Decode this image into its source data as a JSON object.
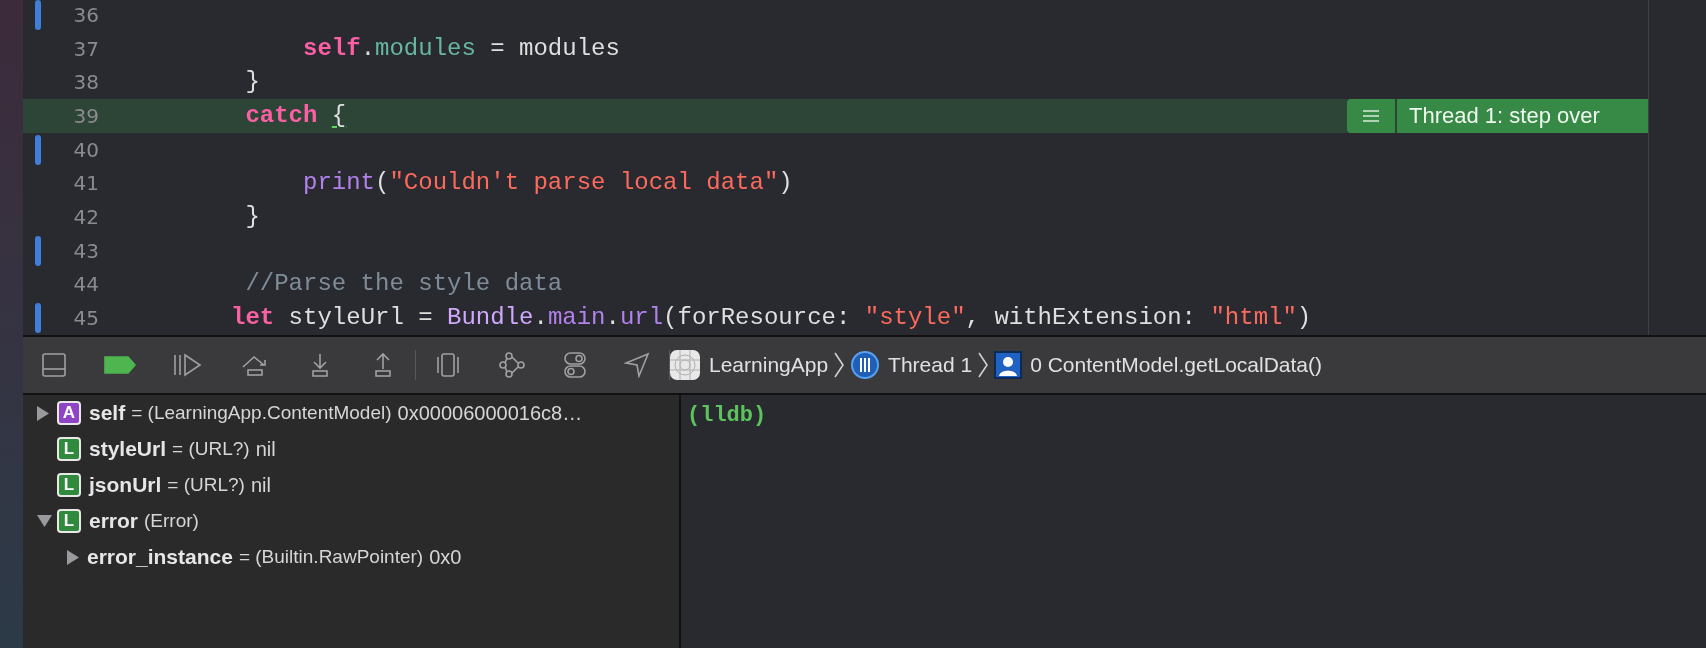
{
  "editor": {
    "lines": [
      {
        "number": "36",
        "changed": true,
        "current": false
      },
      {
        "number": "37",
        "changed": false,
        "current": false,
        "tokens": [
          {
            "kind": "keyword",
            "text": "     self"
          },
          {
            "kind": "plain",
            "text": "."
          },
          {
            "kind": "property",
            "text": "modules"
          },
          {
            "kind": "plain",
            "text": " = modules"
          }
        ]
      },
      {
        "number": "38",
        "changed": false,
        "current": false,
        "tokens": [
          {
            "kind": "plain",
            "text": " }"
          }
        ]
      },
      {
        "number": "39",
        "changed": false,
        "current": true,
        "tokens": [
          {
            "kind": "keyword",
            "text": " catch "
          },
          {
            "kind": "brace-match",
            "text": "{"
          }
        ]
      },
      {
        "number": "40",
        "changed": true,
        "current": false
      },
      {
        "number": "41",
        "changed": false,
        "current": false,
        "tokens": [
          {
            "kind": "function",
            "text": "     print"
          },
          {
            "kind": "plain",
            "text": "("
          },
          {
            "kind": "string",
            "text": "\"Couldn't parse local data\""
          },
          {
            "kind": "plain",
            "text": ")"
          }
        ]
      },
      {
        "number": "42",
        "changed": false,
        "current": false,
        "tokens": [
          {
            "kind": "plain",
            "text": " }"
          }
        ]
      },
      {
        "number": "43",
        "changed": true,
        "current": false
      },
      {
        "number": "44",
        "changed": false,
        "current": false,
        "tokens": [
          {
            "kind": "comment",
            "text": " //Parse the style data"
          }
        ]
      },
      {
        "number": "45",
        "changed": true,
        "current": false,
        "tokens": [
          {
            "kind": "keyword",
            "text": "let"
          },
          {
            "kind": "plain",
            "text": " styleUrl = "
          },
          {
            "kind": "type",
            "text": "Bundle"
          },
          {
            "kind": "plain",
            "text": "."
          },
          {
            "kind": "function",
            "text": "main"
          },
          {
            "kind": "plain",
            "text": "."
          },
          {
            "kind": "function",
            "text": "url"
          },
          {
            "kind": "plain",
            "text": "(forResource: "
          },
          {
            "kind": "string",
            "text": "\"style\""
          },
          {
            "kind": "plain",
            "text": ", withExtension: "
          },
          {
            "kind": "string",
            "text": "\"html\""
          },
          {
            "kind": "plain",
            "text": ")"
          }
        ]
      }
    ],
    "annotation": {
      "label": "Thread 1: step over"
    }
  },
  "debug_bar": {
    "breakpoints_active": true,
    "breadcrumbs": [
      {
        "kind": "app",
        "label": "LearningApp"
      },
      {
        "kind": "thread",
        "label": "Thread 1"
      },
      {
        "kind": "frame",
        "label": "0 ContentModel.getLocalData()"
      }
    ]
  },
  "variables": [
    {
      "kind": "group",
      "expanded": false,
      "badge": {
        "letter": "A",
        "color": "#8e44c4"
      },
      "name": "self",
      "type": "= (LearningApp.ContentModel)",
      "value": "0x00006000016c8…"
    },
    {
      "kind": "leaf",
      "badge": {
        "letter": "L",
        "color": "#2f8a3c"
      },
      "name": "styleUrl",
      "type": "= (URL?)",
      "value": "nil"
    },
    {
      "kind": "leaf",
      "badge": {
        "letter": "L",
        "color": "#2f8a3c"
      },
      "name": "jsonUrl",
      "type": "= (URL?)",
      "value": "nil"
    },
    {
      "kind": "group",
      "expanded": true,
      "badge": {
        "letter": "L",
        "color": "#2f8a3c"
      },
      "name": "error",
      "type": "(Error)",
      "children": [
        {
          "kind": "group",
          "expanded": false,
          "name": "error_instance",
          "type": "= (Builtin.RawPointer)",
          "value": "0x0"
        }
      ]
    }
  ],
  "console": {
    "prompt": "(lldb)"
  }
}
